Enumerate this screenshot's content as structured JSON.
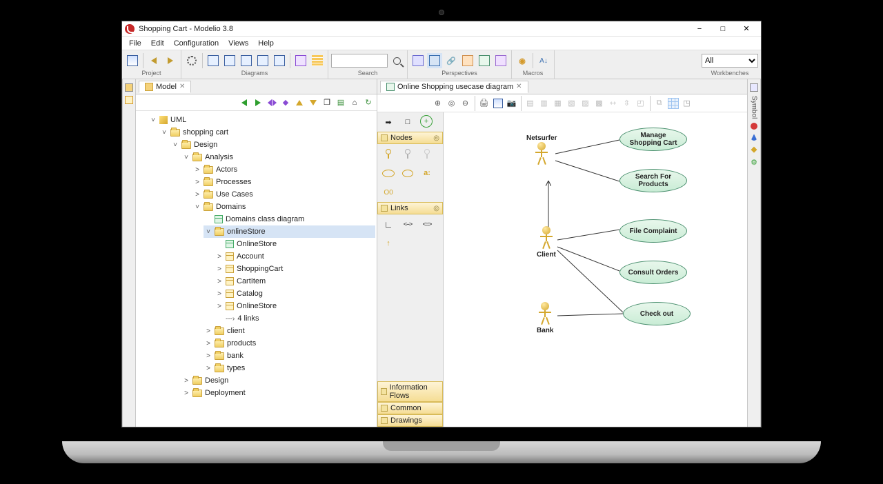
{
  "window": {
    "title": "Shopping Cart - Modelio 3.8"
  },
  "menu": {
    "items": [
      "File",
      "Edit",
      "Configuration",
      "Views",
      "Help"
    ]
  },
  "toolbar": {
    "groups": {
      "project": "Project",
      "diagrams": "Diagrams",
      "search": "Search",
      "perspectives": "Perspectives",
      "macros": "Macros",
      "workbenches": "Workbenches"
    },
    "search_value": "",
    "workbench_value": "All"
  },
  "model_view": {
    "tab": "Model",
    "tree": {
      "root": "UML",
      "l1": "shopping cart",
      "l2a": "Design",
      "l3a": "Analysis",
      "l4": [
        "Actors",
        "Processes",
        "Use Cases",
        "Domains"
      ],
      "l5a": "Domains class diagram",
      "l5b": "onlineStore",
      "l6": [
        "OnlineStore",
        "Account",
        "ShoppingCart",
        "CartItem",
        "Catalog",
        "OnlineStore"
      ],
      "l6links": "4 links",
      "l5rest": [
        "client",
        "products",
        "bank",
        "types"
      ],
      "l3rest": [
        "Design",
        "Deployment"
      ]
    }
  },
  "editor": {
    "tab": "Online Shopping usecase diagram"
  },
  "palette": {
    "sections": {
      "nodes": "Nodes",
      "links": "Links",
      "iflows": "Information Flows",
      "common": "Common",
      "drawings": "Drawings"
    },
    "oo_label": "O0",
    "a_label": "a:"
  },
  "diagram": {
    "actors": {
      "netsurfer": "Netsurfer",
      "client": "Client",
      "bank": "Bank"
    },
    "usecases": {
      "manage": "Manage Shopping Cart",
      "search": "Search For Products",
      "file": "File Complaint",
      "consult": "Consult Orders",
      "checkout": "Check out"
    }
  },
  "right_strip": {
    "label": "Symbol"
  }
}
